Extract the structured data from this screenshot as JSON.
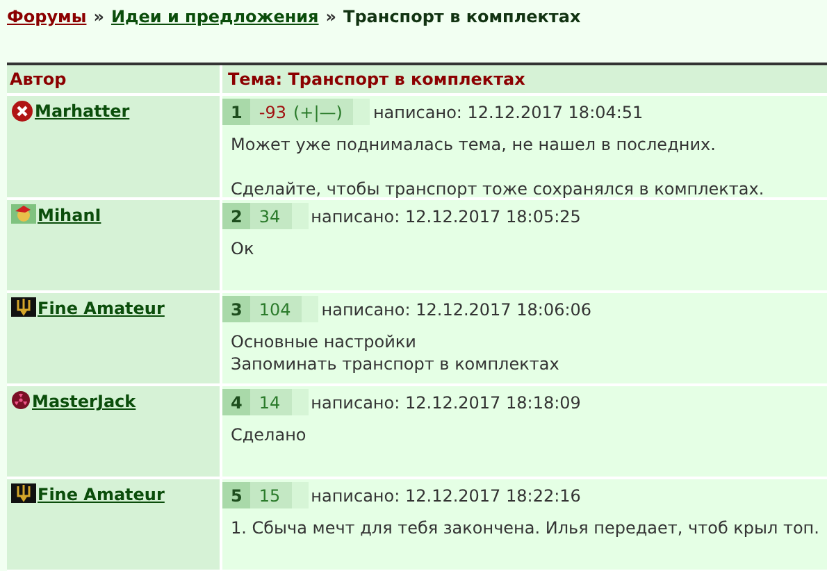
{
  "breadcrumb": [
    {
      "label": "Форумы",
      "link": true,
      "kind": "root"
    },
    {
      "label": "Идеи и предложения",
      "link": true,
      "kind": "section"
    },
    {
      "label": "Транспорт в комплектах",
      "link": false,
      "kind": "current"
    }
  ],
  "separator": "»",
  "table": {
    "columns": [
      "Автор",
      "Тема: Транспорт в комплектах"
    ],
    "posts": [
      {
        "author": "Marhatter",
        "kind": "cross",
        "number": "1",
        "rating": "-93",
        "negative": true,
        "vote": "(+|—)",
        "posted": "написано: 12.12.2017 18:04:51",
        "paragraphs": [
          "Может уже поднималась тема, не нашел в последних.",
          "Сделайте, чтобы транспорт тоже сохранялся в комплектах."
        ]
      },
      {
        "author": "MihanI",
        "kind": "gift",
        "number": "2",
        "rating": "34",
        "negative": false,
        "posted": "написано: 12.12.2017 18:05:25",
        "paragraphs": [
          "Ок"
        ]
      },
      {
        "author": "Fine Amateur",
        "kind": "trident",
        "number": "3",
        "rating": "104",
        "negative": false,
        "posted": "написано: 12.12.2017 18:06:06",
        "paragraphs": [
          "Основные настройки\nЗапоминать транспорт в комплектах"
        ]
      },
      {
        "author": "MasterJack",
        "kind": "radiation",
        "number": "4",
        "rating": "14",
        "negative": false,
        "posted": "написано: 12.12.2017 18:18:09",
        "paragraphs": [
          "Сделано"
        ]
      },
      {
        "author": "Fine Amateur",
        "kind": "trident",
        "number": "5",
        "rating": "15",
        "negative": false,
        "posted": "написано: 12.12.2017 18:22:16",
        "paragraphs": [
          "1. Сбыча мечт для тебя закончена. Илья передает, чтоб крыл топ."
        ]
      }
    ]
  }
}
